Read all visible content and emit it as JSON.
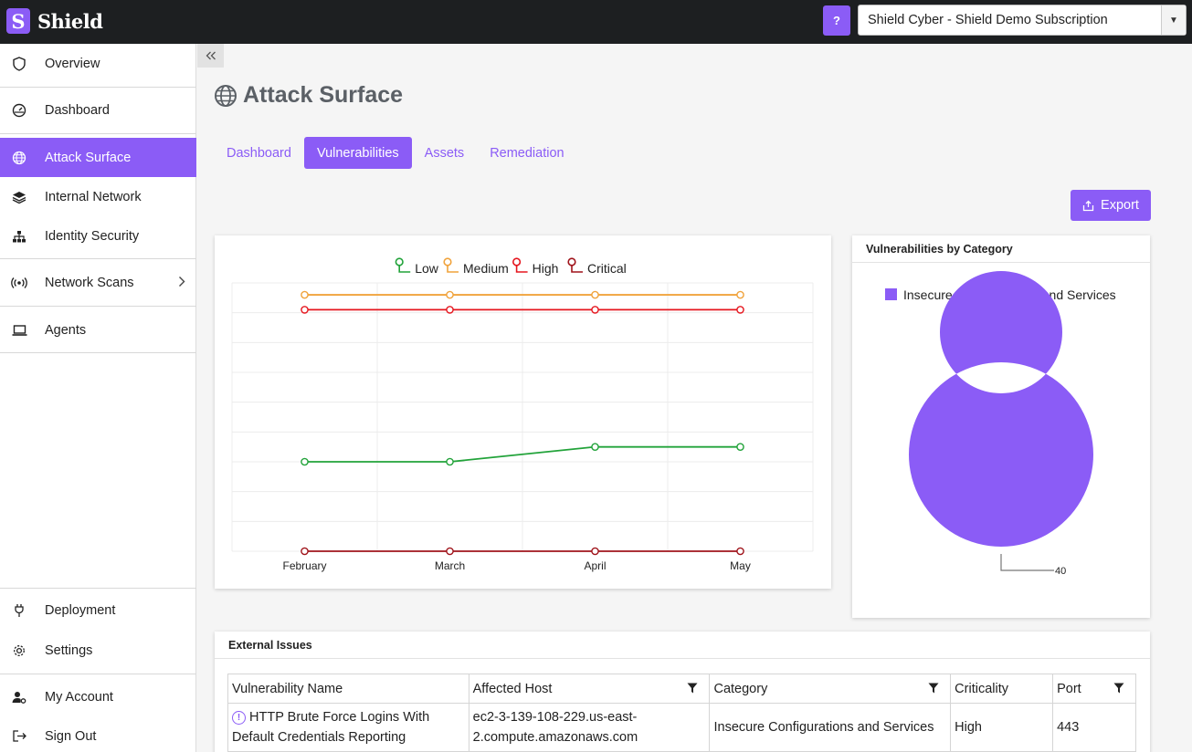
{
  "app": {
    "logo_letter": "S",
    "name": "Shield"
  },
  "topbar": {
    "help_label": "?",
    "subscription": "Shield Cyber - Shield Demo Subscription"
  },
  "sidebar": {
    "items": [
      {
        "label": "Overview",
        "icon": "shield-icon"
      },
      {
        "label": "Dashboard",
        "icon": "gauge-icon"
      },
      {
        "label": "Attack Surface",
        "icon": "globe-icon",
        "active": true
      },
      {
        "label": "Internal Network",
        "icon": "layers-icon"
      },
      {
        "label": "Identity Security",
        "icon": "sitemap-icon"
      },
      {
        "label": "Network Scans",
        "icon": "broadcast-icon"
      },
      {
        "label": "Agents",
        "icon": "laptop-icon"
      },
      {
        "label": "Deployment",
        "icon": "plug-icon"
      },
      {
        "label": "Settings",
        "icon": "gear-icon"
      },
      {
        "label": "My Account",
        "icon": "user-gear-icon"
      },
      {
        "label": "Sign Out",
        "icon": "sign-out-icon"
      }
    ]
  },
  "page": {
    "title": "Attack Surface",
    "tabs": [
      "Dashboard",
      "Vulnerabilities",
      "Assets",
      "Remediation"
    ],
    "active_tab": "Vulnerabilities",
    "export_label": "Export"
  },
  "colors": {
    "accent": "#8b5cf6",
    "low": "#22a33a",
    "medium": "#f0a33c",
    "high": "#e5161e",
    "critical": "#a0141b"
  },
  "chart_data": [
    {
      "type": "line",
      "categories": [
        "February",
        "March",
        "April",
        "May"
      ],
      "series": [
        {
          "name": "Low",
          "values": [
            30,
            30,
            35,
            35
          ]
        },
        {
          "name": "Medium",
          "values": [
            86,
            86,
            86,
            86
          ]
        },
        {
          "name": "High",
          "values": [
            81,
            81,
            81,
            81
          ]
        },
        {
          "name": "Critical",
          "values": [
            0,
            0,
            0,
            0
          ]
        }
      ],
      "ylim": [
        0,
        90
      ],
      "grid": true,
      "legend": "top-center",
      "title": "",
      "xlabel": "",
      "ylabel": ""
    },
    {
      "type": "pie",
      "title": "Vulnerabilities by Category",
      "categories": [
        "Insecure Configurations and Services"
      ],
      "values": [
        40
      ],
      "donut": true,
      "legend": "top"
    }
  ],
  "issues": {
    "title": "External Issues",
    "columns": [
      "Vulnerability Name",
      "Affected Host",
      "Category",
      "Criticality",
      "Port"
    ],
    "rows": [
      {
        "name": "HTTP Brute Force Logins With Default Credentials Reporting",
        "host": "ec2-3-139-108-229.us-east-2.compute.amazonaws.com",
        "category": "Insecure Configurations and Services",
        "criticality": "High",
        "port": "443"
      }
    ]
  }
}
